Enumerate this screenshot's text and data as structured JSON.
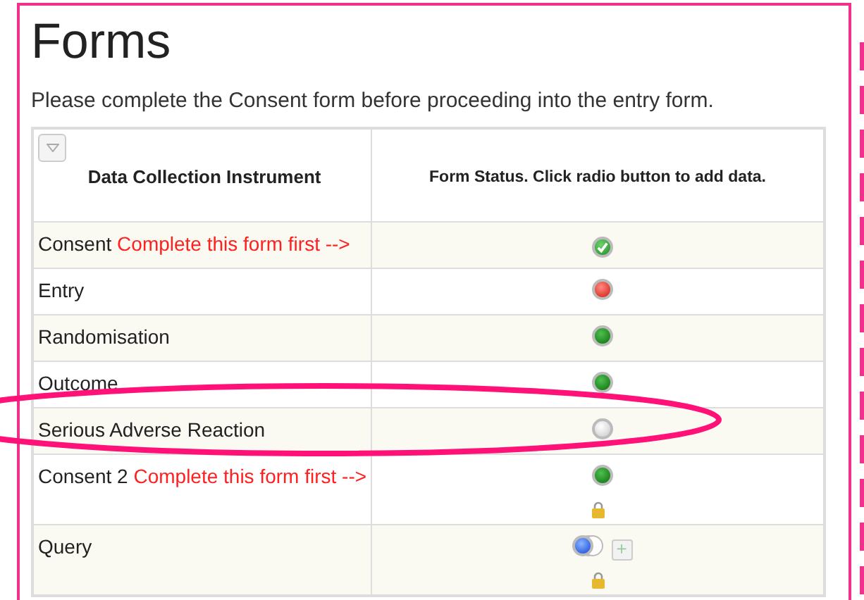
{
  "title": "Forms",
  "instructions": "Please complete the Consent form before proceeding into the entry form.",
  "table": {
    "columns": [
      "Data Collection Instrument",
      "Form Status. Click radio button to add data."
    ],
    "rows": [
      {
        "name": "Consent",
        "note": "Complete this form first -->",
        "kind": "complete",
        "locked": false,
        "multiple": false
      },
      {
        "name": "Entry",
        "kind": "incomplete",
        "locked": false,
        "multiple": false
      },
      {
        "name": "Randomisation",
        "kind": "saved",
        "locked": false,
        "multiple": false
      },
      {
        "name": "Outcome",
        "kind": "saved",
        "locked": false,
        "multiple": false
      },
      {
        "name": "Serious Adverse Reaction",
        "kind": "empty",
        "locked": false,
        "multiple": false
      },
      {
        "name": "Consent 2",
        "note": "Complete this form first -->",
        "kind": "saved",
        "locked": true,
        "multiple": false
      },
      {
        "name": "Query",
        "kind": "mixed",
        "locked": true,
        "multiple": true,
        "add_button": "+"
      }
    ]
  }
}
